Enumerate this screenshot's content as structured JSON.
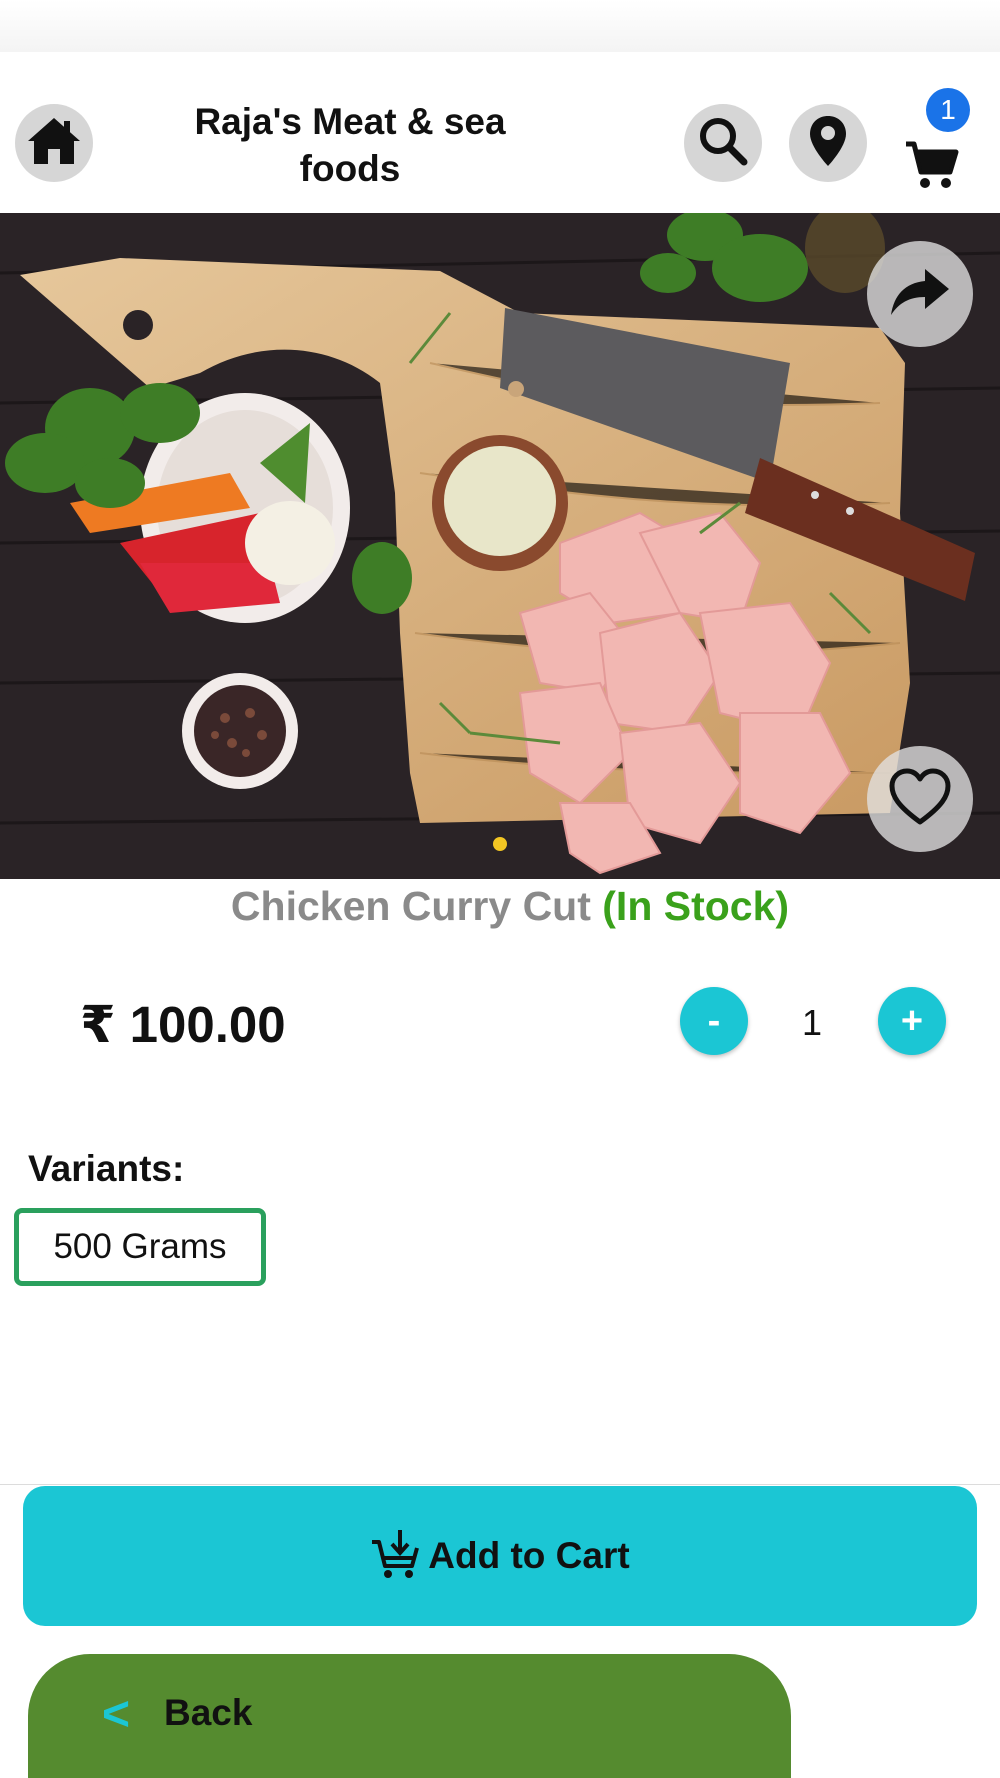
{
  "header": {
    "title": "Raja's Meat & sea foods",
    "cart_count": "1",
    "icons": [
      "home-icon",
      "search-icon",
      "location-pin-icon",
      "cart-icon"
    ]
  },
  "hero": {
    "image_description_icons": [
      "share-icon",
      "heart-icon"
    ],
    "carousel_pages": 1,
    "carousel_active_index": 0
  },
  "product": {
    "name": "Chicken Curry Cut",
    "stock_status": "(In Stock)",
    "price": "₹ 100.00",
    "quantity": "1",
    "decrement_label": "-",
    "increment_label": "+"
  },
  "variants": {
    "label": "Variants:",
    "options": [
      "500 Grams"
    ],
    "selected": "500 Grams"
  },
  "actions": {
    "add_to_cart": "Add to Cart",
    "back": "Back",
    "back_chevron": "<"
  },
  "colors": {
    "accent_cyan": "#1bc6d4",
    "back_green": "#558b2f",
    "in_stock_green": "#3aa11b",
    "variant_border": "#2aa05d",
    "badge_blue": "#1a73e8",
    "carousel_dot": "#f3c623"
  }
}
